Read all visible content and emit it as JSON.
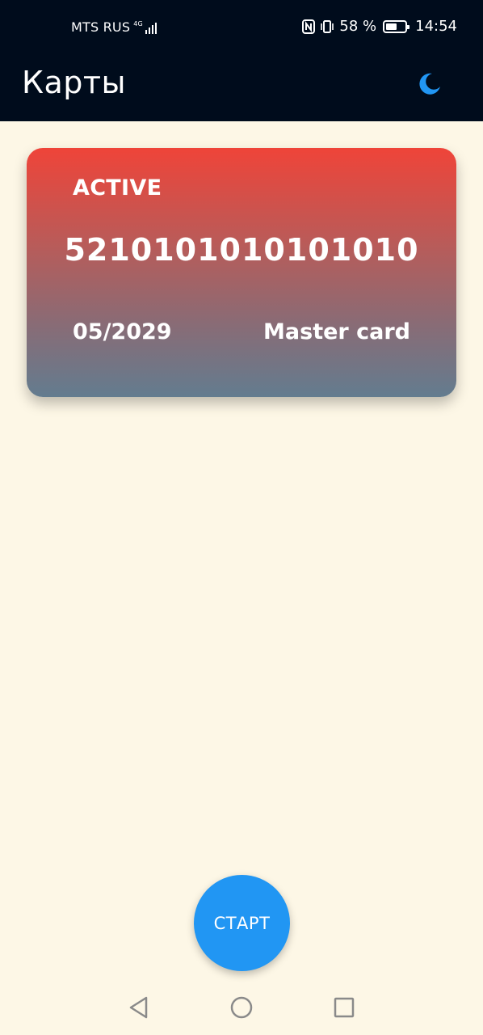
{
  "status_bar": {
    "carrier": "MTS RUS",
    "network_type": "4G",
    "battery_percent": "58 %",
    "battery_level": 0.58,
    "time": "14:54",
    "icons": [
      "signal-icon",
      "nfc-icon",
      "vibrate-icon",
      "battery-icon"
    ]
  },
  "app_bar": {
    "title": "Карты",
    "theme_icon": "moon-icon",
    "theme_icon_color": "#2196F3",
    "background": "#000C1C"
  },
  "card": {
    "status": "ACTIVE",
    "number": "5210101010101010",
    "expiry": "05/2029",
    "brand": "Master card",
    "gradient_top": "#EF4439",
    "gradient_bottom": "#637C8F"
  },
  "fab": {
    "label": "СТАРТ",
    "color": "#2196F3"
  },
  "navigation": {
    "icons": [
      "back-icon",
      "home-icon",
      "recents-icon"
    ]
  },
  "page_background": "#FDF7E6"
}
